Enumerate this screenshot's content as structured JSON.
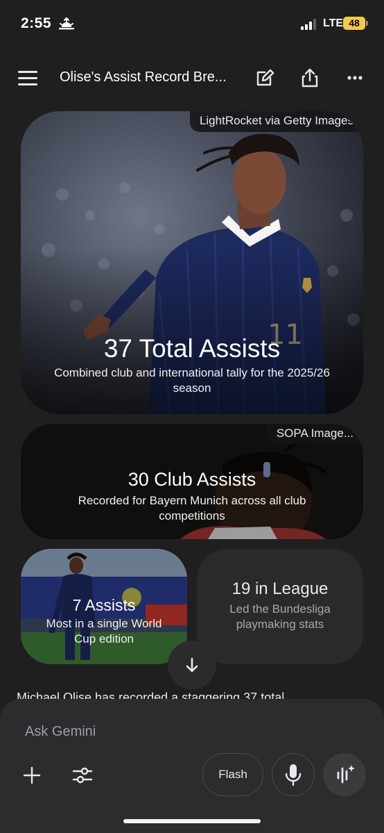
{
  "status_bar": {
    "time": "2:55",
    "network": "LTE",
    "battery": "48"
  },
  "header": {
    "title": "Olise's Assist Record Bre..."
  },
  "cards": [
    {
      "credit": "LightRocket via Getty Images",
      "headline": "37 Total Assists",
      "subtitle": "Combined club and international tally for the 2025/26 season"
    },
    {
      "credit": "SOPA Image...",
      "headline": "30 Club Assists",
      "subtitle": "Recorded for Bayern Munich across all club competitions"
    },
    {
      "headline": "7 Assists",
      "subtitle": "Most in a single World Cup edition"
    },
    {
      "headline": "19 in League",
      "subtitle": "Led the Bundesliga playmaking stats"
    }
  ],
  "body_peek": "Michael Olise has recorded a staggering 37 total",
  "input": {
    "placeholder": "Ask Gemini",
    "model_label": "Flash"
  },
  "colors": {
    "background": "#1f1f20",
    "sheet": "#2c2c2e",
    "battery": "#f2c94c"
  }
}
